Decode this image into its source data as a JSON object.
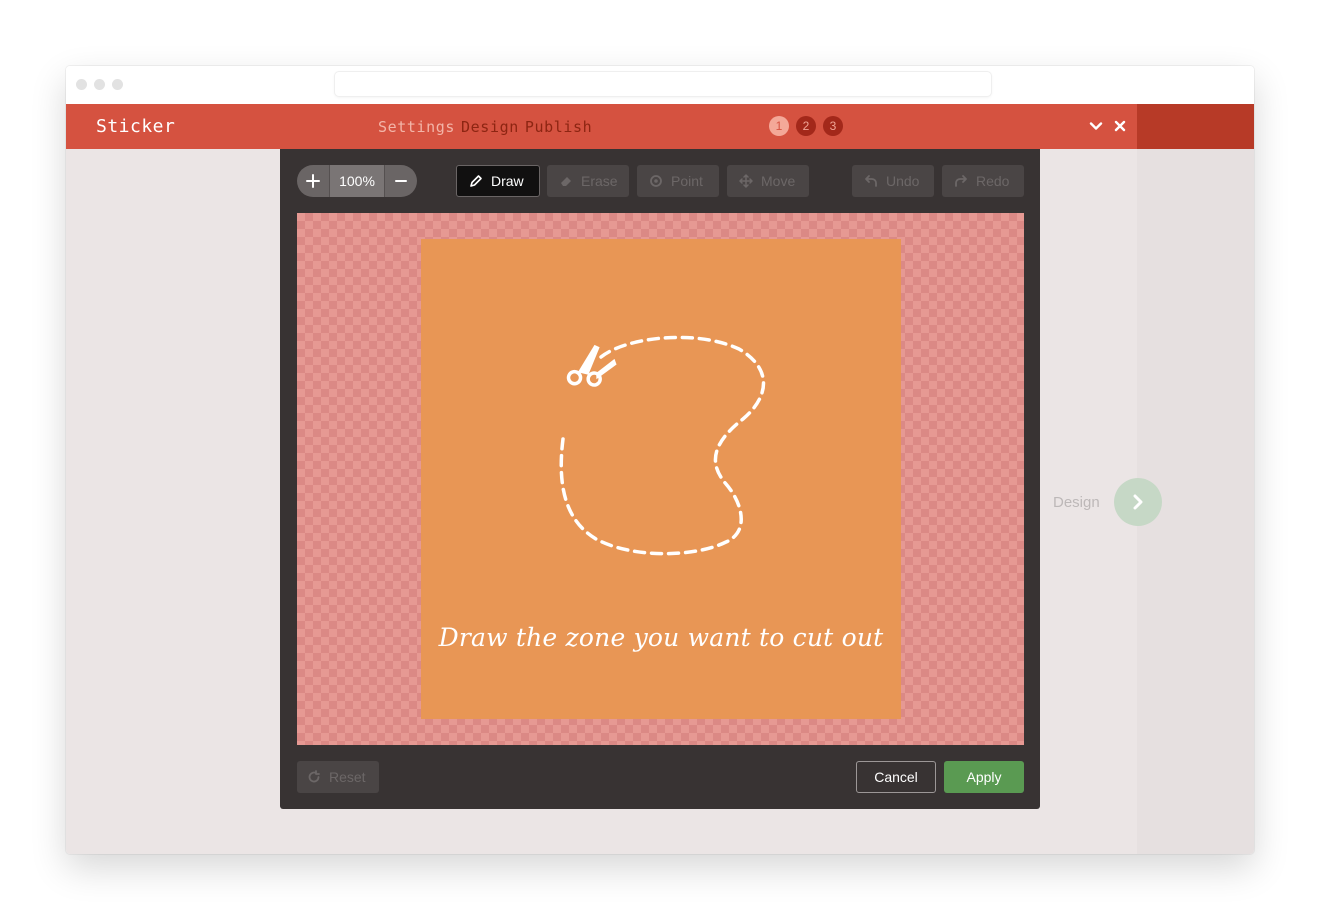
{
  "app": {
    "title": "Sticker"
  },
  "steps": [
    {
      "label": "Settings",
      "number": "1"
    },
    {
      "label": "Design",
      "number": "2"
    },
    {
      "label": "Publish",
      "number": "3"
    }
  ],
  "active_step": 1,
  "header_icons": {
    "collapse": "chevron-down-icon",
    "close": "close-icon"
  },
  "zoom": {
    "value": "100%",
    "zoom_in_icon": "plus-icon",
    "zoom_out_icon": "minus-icon"
  },
  "tools": [
    {
      "label": "Draw",
      "icon": "pencil-icon",
      "active": true
    },
    {
      "label": "Erase",
      "icon": "eraser-icon",
      "active": false
    },
    {
      "label": "Point",
      "icon": "target-icon",
      "active": false
    },
    {
      "label": "Move",
      "icon": "move-icon",
      "active": false
    }
  ],
  "history": [
    {
      "label": "Undo",
      "icon": "undo-icon"
    },
    {
      "label": "Redo",
      "icon": "redo-icon"
    }
  ],
  "stage": {
    "instruction": "Draw the zone you want to cut out",
    "illustration": "scissors-icon"
  },
  "footer": {
    "reset": "Reset",
    "cancel": "Cancel",
    "apply": "Apply"
  },
  "next": {
    "label": "Design",
    "icon": "chevron-right-icon"
  },
  "colors": {
    "header": "#d55240",
    "header_dark": "#b73a27",
    "card": "#e89655",
    "apply": "#5a9a52"
  }
}
